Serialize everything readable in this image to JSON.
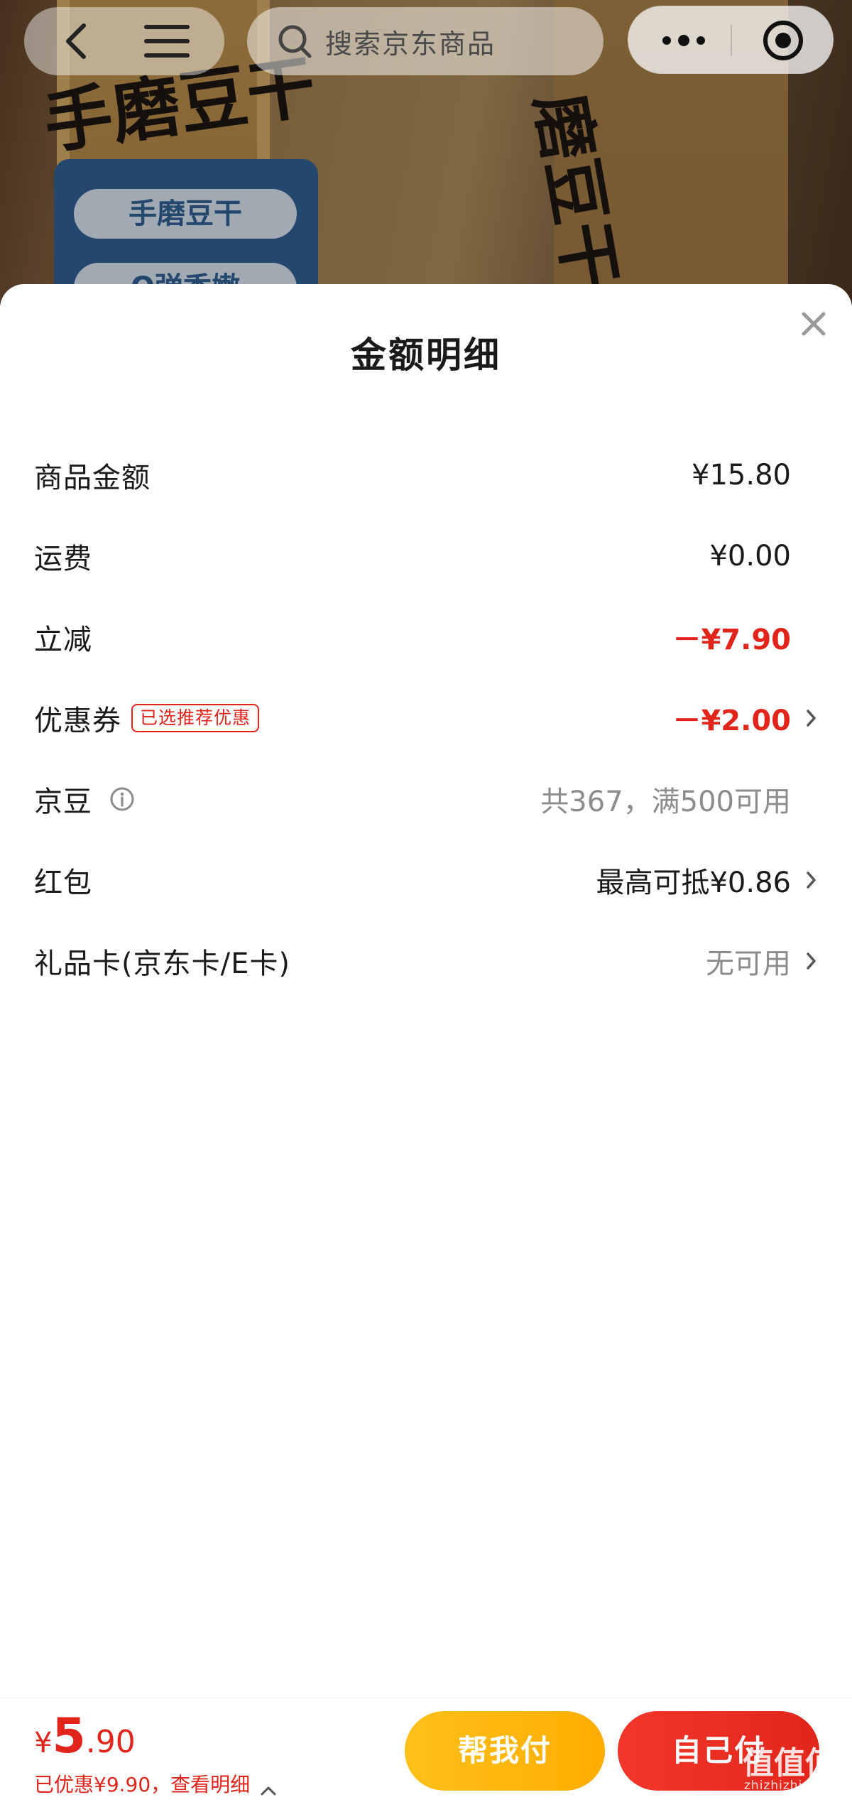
{
  "background": {
    "label_pill_1": "手磨豆干",
    "label_pill_2": "Q弹香嫩",
    "brand_left": "手磨豆干",
    "brand_right": "磨豆干"
  },
  "nav": {
    "search_placeholder": "搜索京东商品"
  },
  "sheet": {
    "title": "金额明细",
    "rows": [
      {
        "label": "商品金额",
        "value": "¥15.80"
      },
      {
        "label": "运费",
        "value": "¥0.00"
      },
      {
        "label": "立减",
        "value": "－¥7.90"
      },
      {
        "label": "优惠券",
        "tag": "已选推荐优惠",
        "value": "－¥2.00"
      },
      {
        "label": "京豆",
        "value": "共367，满500可用"
      },
      {
        "label": "红包",
        "value": "最高可抵¥0.86"
      },
      {
        "label": "礼品卡(京东卡/E卡)",
        "value": "无可用"
      }
    ]
  },
  "paybar": {
    "currency": "¥",
    "price_int": "5",
    "price_dec": ".90",
    "saved_text": "已优惠¥9.90，查看明细",
    "btn_friend": "帮我付",
    "btn_self": "自己付"
  },
  "watermark": {
    "text": "值值值",
    "url": "zhizhizhi.com"
  },
  "colors": {
    "accent_red": "#e1251b",
    "friend_orange": "#ffb300"
  }
}
